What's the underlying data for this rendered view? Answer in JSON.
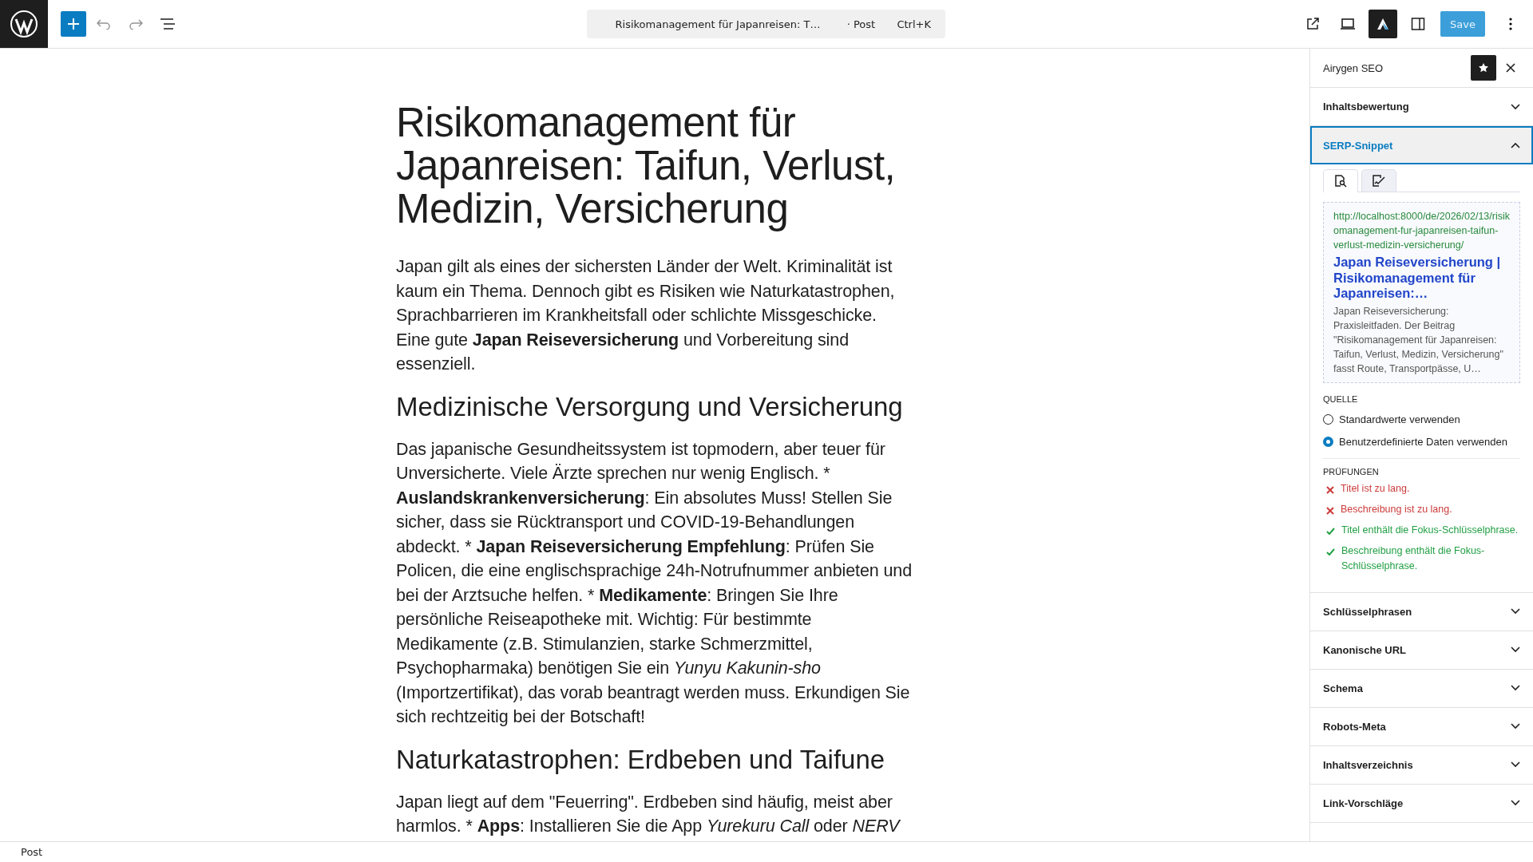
{
  "toolbar": {
    "save_label": "Save"
  },
  "command_bar": {
    "title": "Risikomanagement für Japanreisen: T…",
    "type": "· Post",
    "shortcut": "Ctrl+K"
  },
  "editor": {
    "title": "Risikomanagement für Japanreisen: Taifun, Verlust, Medizin, Versicherung",
    "blocks": [
      {
        "kind": "paragraph",
        "text": "Japan gilt als eines der sichersten Länder der Welt. Kriminalität ist kaum ein Thema. Dennoch gibt es Risiken wie Naturkatastrophen, Sprachbarrieren im Krankheitsfall oder schlichte Missgeschicke. Eine gute **Japan Reiseversicherung** und Vorbereitung sind essenziell."
      },
      {
        "kind": "heading",
        "text": "Medizinische Versorgung und Versicherung"
      },
      {
        "kind": "paragraph",
        "text": "Das japanische Gesundheitssystem ist topmodern, aber teuer für Unversicherte. Viele Ärzte sprechen nur wenig Englisch. * **Auslandskrankenversicherung**: Ein absolutes Muss! Stellen Sie sicher, dass sie Rücktransport und COVID-19-Behandlungen abdeckt. * **Japan Reiseversicherung Empfehlung**: Prüfen Sie Policen, die eine englischsprachige 24h-Notrufnummer anbieten und bei der Arztsuche helfen. * **Medikamente**: Bringen Sie Ihre persönliche Reiseapotheke mit. Wichtig: Für bestimmte Medikamente (z.B. Stimulanzien, starke Schmerzmittel, Psychopharmaka) benötigen Sie ein *Yunyu Kakunin-sho* (Importzertifikat), das vorab beantragt werden muss. Erkundigen Sie sich rechtzeitig bei der Botschaft!"
      },
      {
        "kind": "heading",
        "text": "Naturkatastrophen: Erdbeben und Taifune"
      },
      {
        "kind": "paragraph",
        "text": "Japan liegt auf dem \"Feuerring\". Erdbeben sind häufig, meist aber harmlos. * **Apps**: Installieren Sie die App *Yurekuru Call* oder *NERV*"
      }
    ]
  },
  "sidebar": {
    "title": "Airygen SEO",
    "panels": [
      {
        "title": "Inhaltsbewertung",
        "expanded": false
      },
      {
        "title": "SERP-Snippet",
        "expanded": true,
        "content": {
          "tabs": [
            {
              "kind": "preview",
              "selected": true
            },
            {
              "kind": "edit",
              "selected": false
            }
          ],
          "preview": {
            "url": "http://localhost:8000/de/2026/02/13/risikomanagement-fur-japanreisen-taifun-verlust-medizin-versicherung/",
            "title": "Japan Reiseversicherung | Risikomanagement für Japanreisen:…",
            "description": "Japan Reiseversicherung: Praxisleitfaden. Der Beitrag \"Risikomanagement für Japanreisen: Taifun, Verlust, Medizin, Versicherung\" fasst Route, Transportpässe, U…"
          },
          "source": {
            "label": "QUELLE",
            "options": [
              {
                "label": "Standardwerte verwenden",
                "selected": false
              },
              {
                "label": "Benutzerdefinierte Daten verwenden",
                "selected": true
              }
            ]
          },
          "checks": {
            "label": "PRÜFUNGEN",
            "items": [
              {
                "text": "Titel ist zu lang.",
                "passed": false
              },
              {
                "text": "Beschreibung ist zu lang.",
                "passed": false
              },
              {
                "text": "Titel enthält die Fokus-Schlüsselphrase.",
                "passed": true
              },
              {
                "text": "Beschreibung enthält die Fokus-Schlüsselphrase.",
                "passed": true
              }
            ]
          }
        }
      },
      {
        "title": "Schlüsselphrasen",
        "expanded": false
      },
      {
        "title": "Kanonische URL",
        "expanded": false
      },
      {
        "title": "Schema",
        "expanded": false
      },
      {
        "title": "Robots-Meta",
        "expanded": false
      },
      {
        "title": "Inhaltsverzeichnis",
        "expanded": false
      },
      {
        "title": "Link-Vorschläge",
        "expanded": false
      }
    ]
  },
  "footer": {
    "breadcrumb": "Post"
  }
}
